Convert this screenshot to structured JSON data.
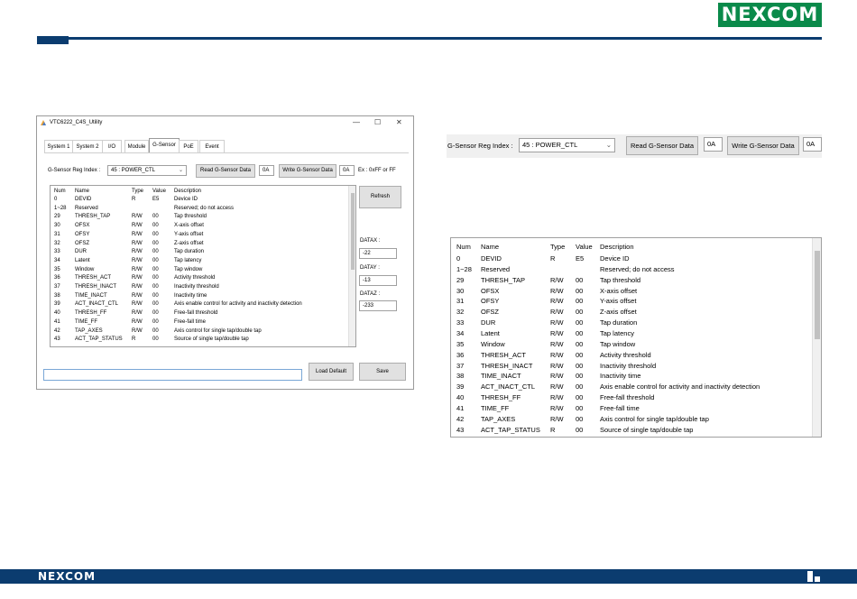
{
  "brand": {
    "name": "NEXCOM",
    "color": "#0a8a4a",
    "navy": "#0b3c6f"
  },
  "window": {
    "title": "VTC6222_C4S_Utility",
    "controls": [
      "—",
      "☐",
      "✕"
    ],
    "tabs": [
      "System 1",
      "System 2",
      "I/O",
      "Module",
      "G-Sensor",
      "PoE",
      "Event"
    ],
    "active_tab": "G-Sensor",
    "reg_index_label": "G-Sensor Reg Index :",
    "reg_index_value": "45 : POWER_CTL",
    "read_button": "Read G-Sensor Data",
    "read_value": "0A",
    "write_button": "Write G-Sensor Data",
    "write_value": "0A",
    "hint": "Ex : 0xFF or FF",
    "refresh_button": "Refresh",
    "datax_label": "DATAX :",
    "datax_value": "-22",
    "datay_label": "DATAY :",
    "datay_value": "-13",
    "dataz_label": "DATAZ :",
    "dataz_value": "-233",
    "load_default_button": "Load Default",
    "save_button": "Save"
  },
  "table": {
    "columns": [
      "Num",
      "Name",
      "Type",
      "Value",
      "Description"
    ],
    "rows": [
      [
        "0",
        "DEVID",
        "R",
        "E5",
        "Device ID"
      ],
      [
        "1~28",
        "Reserved",
        "",
        "",
        "Reserved; do not access"
      ],
      [
        "29",
        "THRESH_TAP",
        "R/W",
        "00",
        "Tap threshold"
      ],
      [
        "30",
        "OFSX",
        "R/W",
        "00",
        "X-axis offset"
      ],
      [
        "31",
        "OFSY",
        "R/W",
        "00",
        "Y-axis offset"
      ],
      [
        "32",
        "OFSZ",
        "R/W",
        "00",
        "Z-axis offset"
      ],
      [
        "33",
        "DUR",
        "R/W",
        "00",
        "Tap duration"
      ],
      [
        "34",
        "Latent",
        "R/W",
        "00",
        "Tap latency"
      ],
      [
        "35",
        "Window",
        "R/W",
        "00",
        "Tap window"
      ],
      [
        "36",
        "THRESH_ACT",
        "R/W",
        "00",
        "Activity threshold"
      ],
      [
        "37",
        "THRESH_INACT",
        "R/W",
        "00",
        "Inactivity threshold"
      ],
      [
        "38",
        "TIME_INACT",
        "R/W",
        "00",
        "Inactivity time"
      ],
      [
        "39",
        "ACT_INACT_CTL",
        "R/W",
        "00",
        "Axis enable control for activity and inactivity detection"
      ],
      [
        "40",
        "THRESH_FF",
        "R/W",
        "00",
        "Free-fall threshold"
      ],
      [
        "41",
        "TIME_FF",
        "R/W",
        "00",
        "Free-fall time"
      ],
      [
        "42",
        "TAP_AXES",
        "R/W",
        "00",
        "Axis control for single tap/double tap"
      ],
      [
        "43",
        "ACT_TAP_STATUS",
        "R",
        "00",
        "Source of single tap/double tap"
      ]
    ]
  },
  "zoom_bar": {
    "reg_index_label": "G-Sensor Reg Index :",
    "reg_index_value": "45 : POWER_CTL",
    "read_button": "Read G-Sensor Data",
    "read_value": "0A",
    "write_button": "Write G-Sensor Data",
    "write_value": "0A"
  },
  "footer": {
    "logo": "NEXCOM"
  }
}
